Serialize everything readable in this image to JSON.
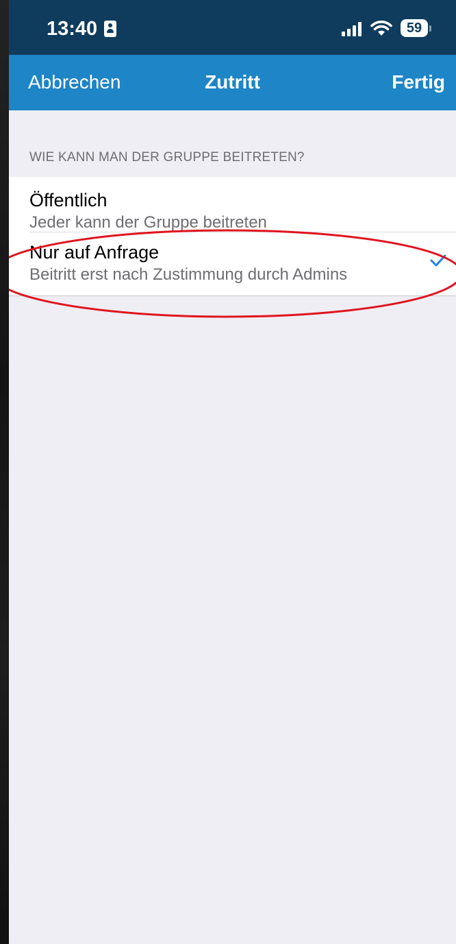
{
  "status_bar": {
    "time": "13:40",
    "battery_level": "59"
  },
  "nav": {
    "cancel_label": "Abbrechen",
    "title": "Zutritt",
    "done_label": "Fertig"
  },
  "section": {
    "header": "WIE KANN MAN DER GRUPPE BEITRETEN?",
    "options": [
      {
        "title": "Öffentlich",
        "subtitle": "Jeder kann der Gruppe beitreten",
        "selected": false
      },
      {
        "title": "Nur auf Anfrage",
        "subtitle": "Beitritt erst nach Zustimmung durch Admins",
        "selected": true
      }
    ]
  },
  "colors": {
    "nav_background": "#1e85c6",
    "status_background": "#0f3c5c",
    "check_color": "#1e85e6",
    "annotation_color": "#e0141e"
  },
  "icons": {
    "contact": "contact-card-icon",
    "signal": "cellular-signal-icon",
    "wifi": "wifi-icon",
    "battery": "battery-icon",
    "check": "checkmark-icon"
  }
}
